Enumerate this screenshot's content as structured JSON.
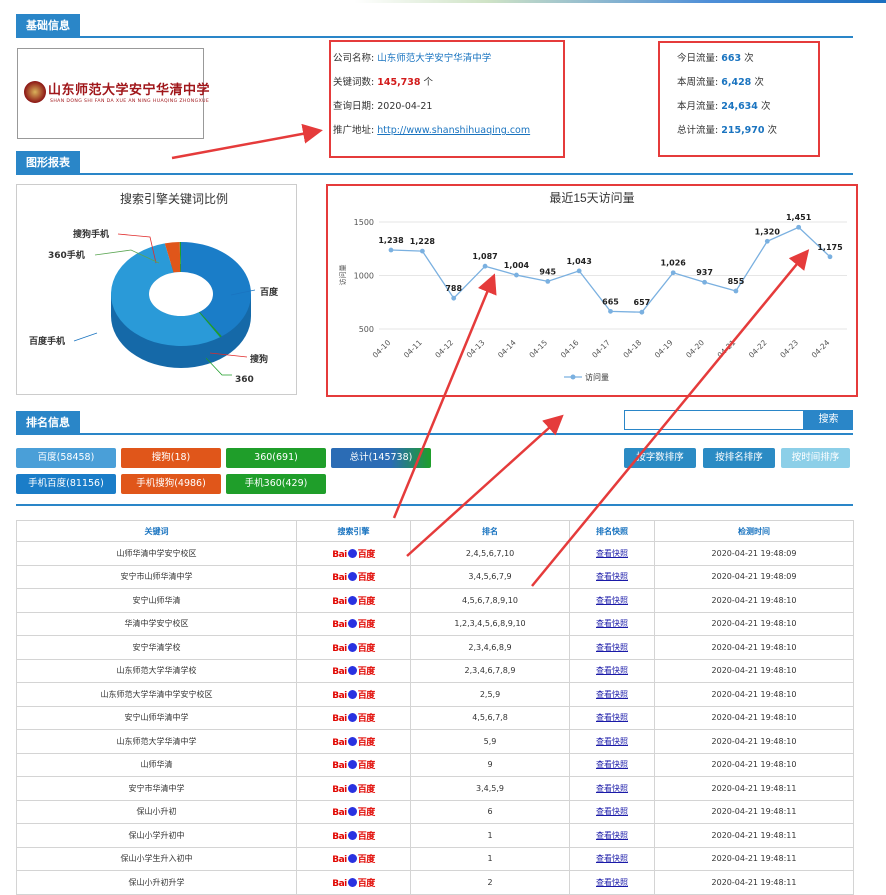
{
  "sections": {
    "basic": "基础信息",
    "chart": "图形报表",
    "ranking": "排名信息"
  },
  "logo": {
    "cn": "山东师范大学安宁华清中学",
    "en": "SHAN DONG SHI FAN DA XUE AN NING HUAQING ZHONGXUE"
  },
  "company": {
    "name_label": "公司名称:",
    "name": "山东师范大学安宁华清中学",
    "kw_label": "关键词数:",
    "kw_count": "145,738",
    "kw_unit": "个",
    "date_label": "查询日期:",
    "date": "2020-04-21",
    "url_label": "推广地址:",
    "url": "http://www.shanshihuaqing.com"
  },
  "traffic": [
    {
      "label": "今日流量:",
      "value": "663",
      "unit": "次"
    },
    {
      "label": "本周流量:",
      "value": "6,428",
      "unit": "次"
    },
    {
      "label": "本月流量:",
      "value": "24,634",
      "unit": "次"
    },
    {
      "label": "总计流量:",
      "value": "215,970",
      "unit": "次"
    }
  ],
  "pie_title": "搜索引擎关键词比例",
  "pie_labels": {
    "sogou_mobile": "搜狗手机",
    "m360": "360手机",
    "baidu": "百度",
    "baidu_mobile": "百度手机",
    "sogou": "搜狗",
    "s360": "360"
  },
  "chart_data": [
    {
      "type": "pie",
      "title": "搜索引擎关键词比例",
      "categories": [
        "百度",
        "搜狗",
        "360",
        "百度手机",
        "搜狗手机",
        "360手机"
      ],
      "values": [
        58458,
        18,
        691,
        81156,
        4986,
        429
      ]
    },
    {
      "type": "line",
      "title": "最近15天访问量",
      "ylabel": "访问量",
      "categories": [
        "04-10",
        "04-11",
        "04-12",
        "04-13",
        "04-14",
        "04-15",
        "04-16",
        "04-17",
        "04-18",
        "04-19",
        "04-20",
        "04-21",
        "04-22",
        "04-23",
        "04-24"
      ],
      "series": [
        {
          "name": "访问量",
          "values": [
            1238,
            1228,
            788,
            1087,
            1004,
            945,
            1043,
            665,
            657,
            1026,
            937,
            855,
            1320,
            1451,
            1175
          ]
        }
      ],
      "value_labels": [
        "1,238",
        "1,228",
        "788",
        "1,087",
        "1,004",
        "945",
        "1,043",
        "665",
        "657",
        "1,026",
        "937",
        "855",
        "1,320",
        "1,451",
        "1,175"
      ],
      "yticks": [
        "1500",
        "1000",
        "500"
      ],
      "ylim": [
        500,
        1500
      ],
      "legend": "bottom",
      "grid": true
    }
  ],
  "line_title": "最近15天访问量",
  "line_ylabel": "访问量",
  "line_legend": "访问量",
  "search": {
    "button": "搜索",
    "placeholder": ""
  },
  "engine_buttons": [
    {
      "label": "百度(58458)",
      "color": "#4a9fd8"
    },
    {
      "label": "搜狗(18)",
      "color": "#e0561a"
    },
    {
      "label": "360(691)",
      "color": "#1f9e2a"
    },
    {
      "label": "总计(145738)",
      "color": "#2b6cb5"
    },
    {
      "label": "手机百度(81156)",
      "color": "#1a7dc8"
    },
    {
      "label": "手机搜狗(4986)",
      "color": "#e0561a"
    },
    {
      "label": "手机360(429)",
      "color": "#1f9e2a"
    }
  ],
  "sort_buttons": [
    "按字数排序",
    "按排名排序",
    "按时间排序"
  ],
  "table": {
    "headers": [
      "关键词",
      "搜索引擎",
      "排名",
      "排名快照",
      "检测时间"
    ],
    "engine_text": "Bai 百度",
    "snapshot": "查看快照",
    "rows": [
      [
        "山师华清中学安宁校区",
        "2,4,5,6,7,10",
        "2020-04-21 19:48:09"
      ],
      [
        "安宁市山师华清中学",
        "3,4,5,6,7,9",
        "2020-04-21 19:48:09"
      ],
      [
        "安宁山师华清",
        "4,5,6,7,8,9,10",
        "2020-04-21 19:48:10"
      ],
      [
        "华清中学安宁校区",
        "1,2,3,4,5,6,8,9,10",
        "2020-04-21 19:48:10"
      ],
      [
        "安宁华清学校",
        "2,3,4,6,8,9",
        "2020-04-21 19:48:10"
      ],
      [
        "山东师范大学华清学校",
        "2,3,4,6,7,8,9",
        "2020-04-21 19:48:10"
      ],
      [
        "山东师范大学华清中学安宁校区",
        "2,5,9",
        "2020-04-21 19:48:10"
      ],
      [
        "安宁山师华清中学",
        "4,5,6,7,8",
        "2020-04-21 19:48:10"
      ],
      [
        "山东师范大学华清中学",
        "5,9",
        "2020-04-21 19:48:10"
      ],
      [
        "山师华清",
        "9",
        "2020-04-21 19:48:10"
      ],
      [
        "安宁市华清中学",
        "3,4,5,9",
        "2020-04-21 19:48:11"
      ],
      [
        "保山小升初",
        "6",
        "2020-04-21 19:48:11"
      ],
      [
        "保山小学升初中",
        "1",
        "2020-04-21 19:48:11"
      ],
      [
        "保山小学生升入初中",
        "1",
        "2020-04-21 19:48:11"
      ],
      [
        "保山小升初升学",
        "2",
        "2020-04-21 19:48:11"
      ]
    ]
  }
}
